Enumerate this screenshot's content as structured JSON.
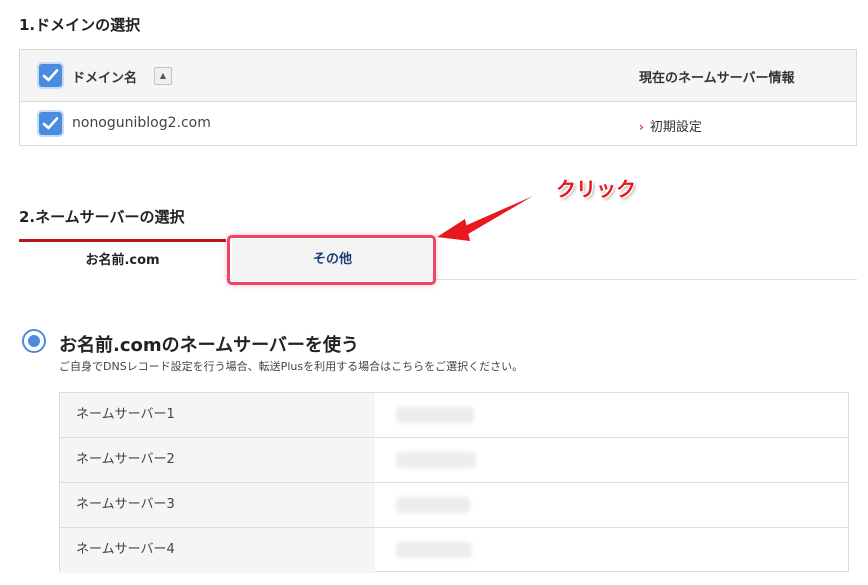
{
  "section1": {
    "title": "1.ドメインの選択",
    "table": {
      "col_domain": "ドメイン名",
      "sort_glyph": "▲",
      "col_nameserver": "現在のネームサーバー情報",
      "rows": [
        {
          "domain": "nonoguniblog2.com",
          "nameserver_link": "初期設定",
          "checked": true
        }
      ]
    }
  },
  "section2": {
    "title": "2.ネームサーバーの選択",
    "tabs": [
      {
        "label": "お名前.com",
        "active": true
      },
      {
        "label": "その他",
        "active": false
      }
    ]
  },
  "annotation": {
    "text": "クリック",
    "color": "#e8161e"
  },
  "option": {
    "title": "お名前.comのネームサーバーを使う",
    "description": "ご自身でDNSレコード設定を行う場合、転送Plusを利用する場合はこちらをご選択ください。",
    "selected": true
  },
  "nameservers": [
    {
      "label": "ネームサーバー1"
    },
    {
      "label": "ネームサーバー2"
    },
    {
      "label": "ネームサーバー3"
    },
    {
      "label": "ネームサーバー4"
    }
  ],
  "colors": {
    "accent_blue": "#4a8ce0",
    "tab_active_border": "#b9151b",
    "highlight": "#e94763",
    "link_chevron": "#cc0000"
  }
}
